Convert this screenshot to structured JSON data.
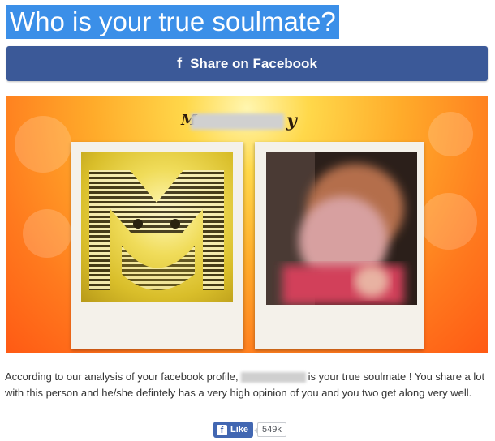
{
  "page": {
    "title": "Who is your true soulmate?"
  },
  "share": {
    "icon": "facebook-f-icon",
    "label": "Share on Facebook",
    "color": "#3b5998"
  },
  "result": {
    "name_prefix_visible": "M",
    "name_suffix_visible": "y"
  },
  "description": {
    "part1": "According to our analysis of your facebook profile,",
    "part2": "is your true soulmate ! You share a lot with this person and he/she defintely has a very high opinion of you and you two get along very well."
  },
  "like": {
    "label": "Like",
    "count": "549k",
    "color": "#4267b2"
  },
  "colors": {
    "title_highlight": "#3b8fe8",
    "background_glow": "#ff8a1e"
  }
}
